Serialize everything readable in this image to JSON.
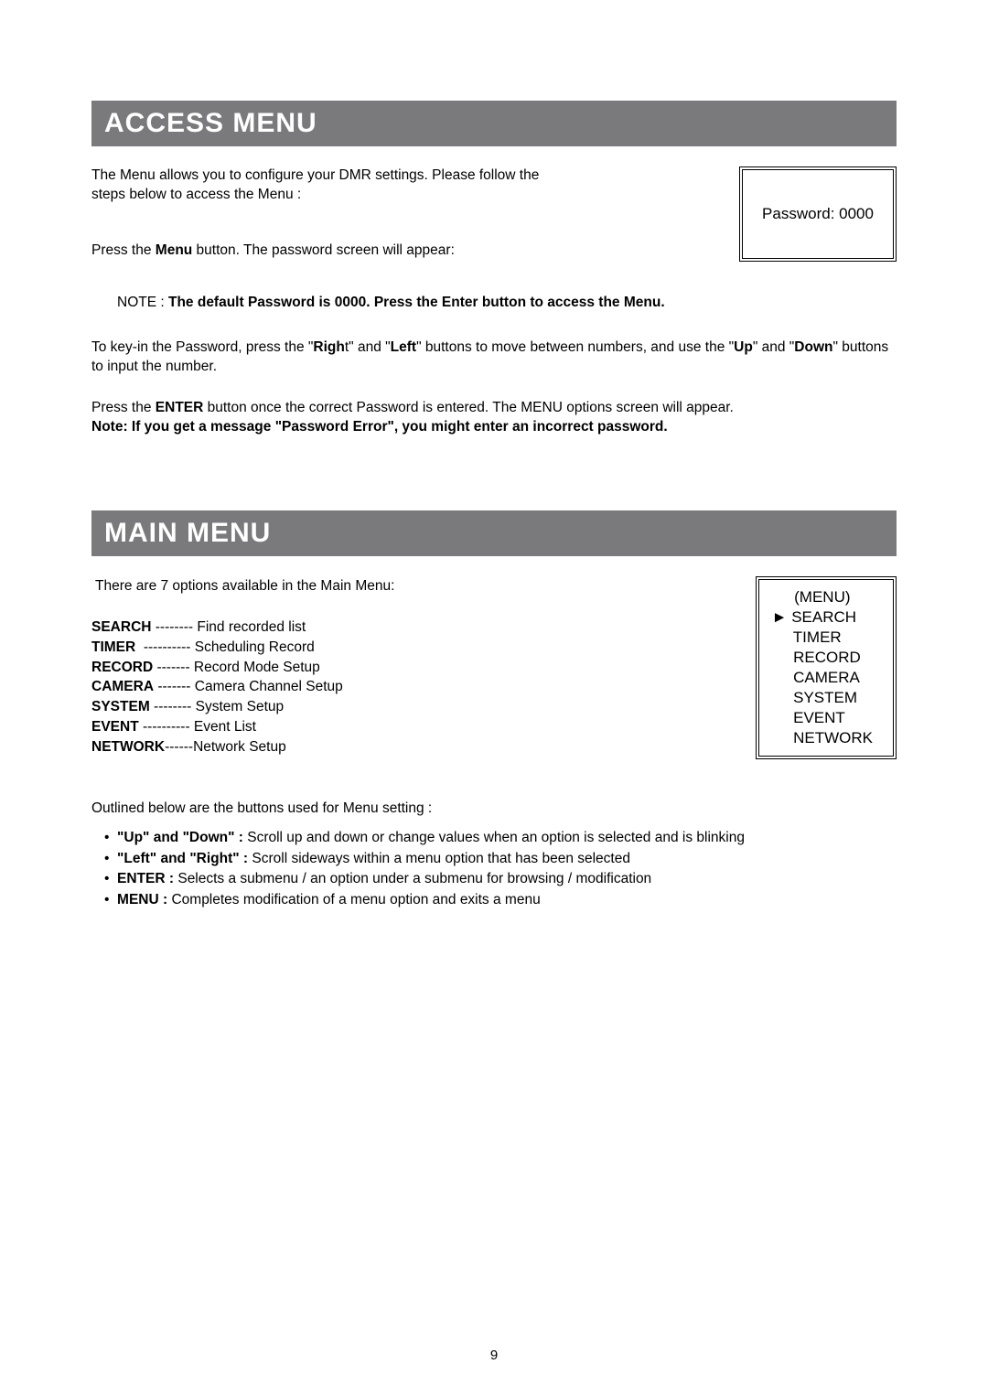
{
  "accessMenu": {
    "title": "ACCESS MENU",
    "intro": "The Menu allows you to configure your DMR settings. Please follow the steps below to access the Menu :",
    "pressPrefix": "Press the ",
    "pressBold": "Menu",
    "pressSuffix": " button. The password screen will appear:",
    "passwordBox": "Password: 0000",
    "noteLabel": "NOTE : ",
    "noteText": "The default Password is 0000. Press the Enter button to access the Menu.",
    "keyin": {
      "p1a": "To key-in the Password, press the \"",
      "p1b": "Righ",
      "p1c": "t\" and \"",
      "p1d": "Left",
      "p1e": "\" buttons to move between numbers, and use the \"",
      "p1f": "Up",
      "p1g": "\" and \"",
      "p1h": "Down",
      "p1i": "\" buttons to input the number."
    },
    "enter": {
      "a": "Press the ",
      "b": "ENTER",
      "c": " button once the correct Password is entered. The MENU options screen will appear."
    },
    "errorNote": "Note: If you get a message \"Password Error\", you might enter an incorrect password."
  },
  "mainMenu": {
    "title": "MAIN MENU",
    "intro": "There are 7 options available in the Main Menu:",
    "options": [
      {
        "name": "SEARCH",
        "dash": " -------- ",
        "desc": "Find recorded list"
      },
      {
        "name": "TIMER",
        "dash": "  ---------- ",
        "desc": "Scheduling Record"
      },
      {
        "name": "RECORD",
        "dash": " ------- ",
        "desc": "Record Mode Setup"
      },
      {
        "name": "CAMERA",
        "dash": " ------- ",
        "desc": "Camera Channel Setup"
      },
      {
        "name": "SYSTEM",
        "dash": " -------- ",
        "desc": "System Setup"
      },
      {
        "name": "EVENT",
        "dash": " ---------- ",
        "desc": "Event List"
      },
      {
        "name": "NETWORK",
        "dash": "------",
        "desc": "Network Setup"
      }
    ],
    "menuBox": {
      "title": "(MENU)",
      "items": [
        "SEARCH",
        "TIMER",
        "RECORD",
        "CAMERA",
        "SYSTEM",
        "EVENT",
        "NETWORK"
      ]
    },
    "outlined": "Outlined below are the buttons used for Menu setting :",
    "bullets": [
      {
        "b": "\"Up\" and \"Down\" :",
        "t": " Scroll up and down or change values when an option is selected and is blinking"
      },
      {
        "b": "\"Left\" and \"Right\"  :",
        "t": " Scroll sideways within a menu option that has been selected"
      },
      {
        "b": "ENTER :",
        "t": " Selects a submenu / an option under a submenu for browsing / modification"
      },
      {
        "b": "MENU :",
        "t": " Completes modification of a menu option and exits a menu"
      }
    ]
  },
  "pageNumber": "9"
}
